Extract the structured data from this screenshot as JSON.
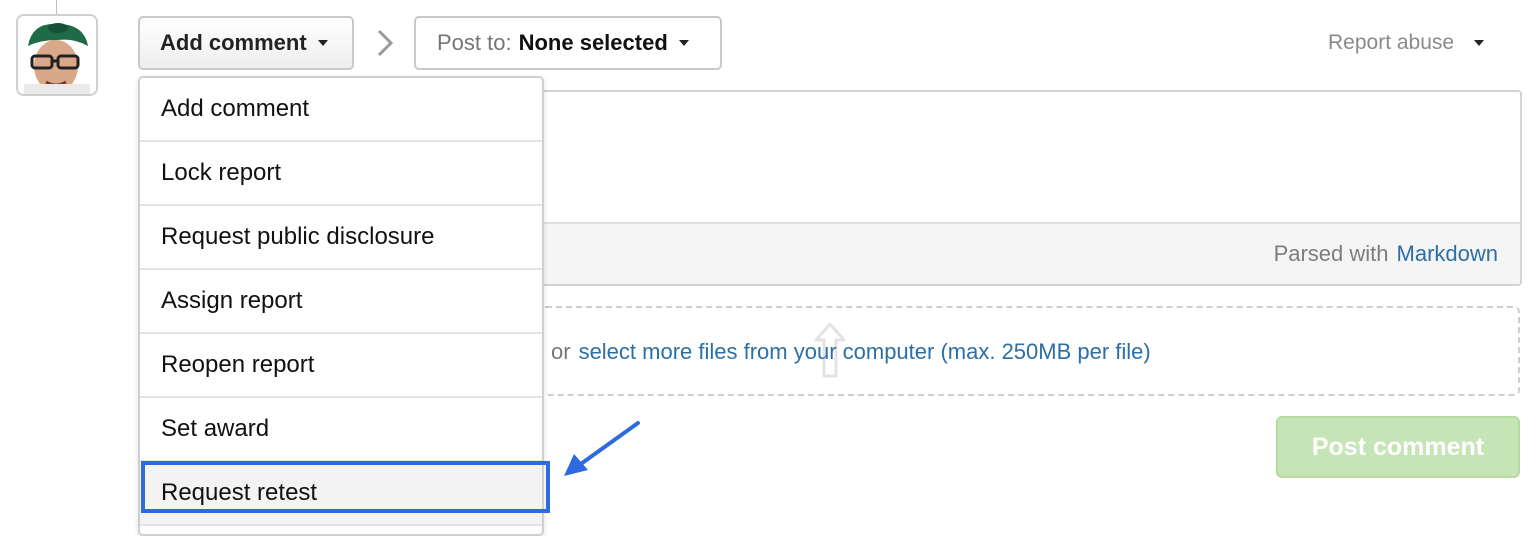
{
  "toolbar": {
    "action_button_label": "Add comment",
    "post_to_label": "Post to:",
    "post_to_value": "None selected",
    "report_abuse_label": "Report abuse"
  },
  "actions_menu": {
    "items": [
      {
        "label": "Add comment"
      },
      {
        "label": "Lock report"
      },
      {
        "label": "Request public disclosure"
      },
      {
        "label": "Assign report"
      },
      {
        "label": "Reopen report"
      },
      {
        "label": "Set award"
      },
      {
        "label": "Request retest"
      }
    ],
    "highlighted_item": "Request retest"
  },
  "editor": {
    "parsed_with_text": "Parsed with",
    "markdown_link": "Markdown"
  },
  "attachments": {
    "or_text": "or",
    "select_files_link": "select more files from your computer (max. 250MB per file)"
  },
  "submit": {
    "post_comment_label": "Post comment"
  },
  "icons": {
    "avatar": "user-avatar",
    "breadcrumb_separator": "chevron-right-icon",
    "upload": "upload-icon",
    "annotation": "arrow-icon"
  },
  "colors": {
    "link": "#2d6fa5",
    "post_button_disabled": "#c6e5b7",
    "annotation_blue": "#2d6ae0"
  }
}
